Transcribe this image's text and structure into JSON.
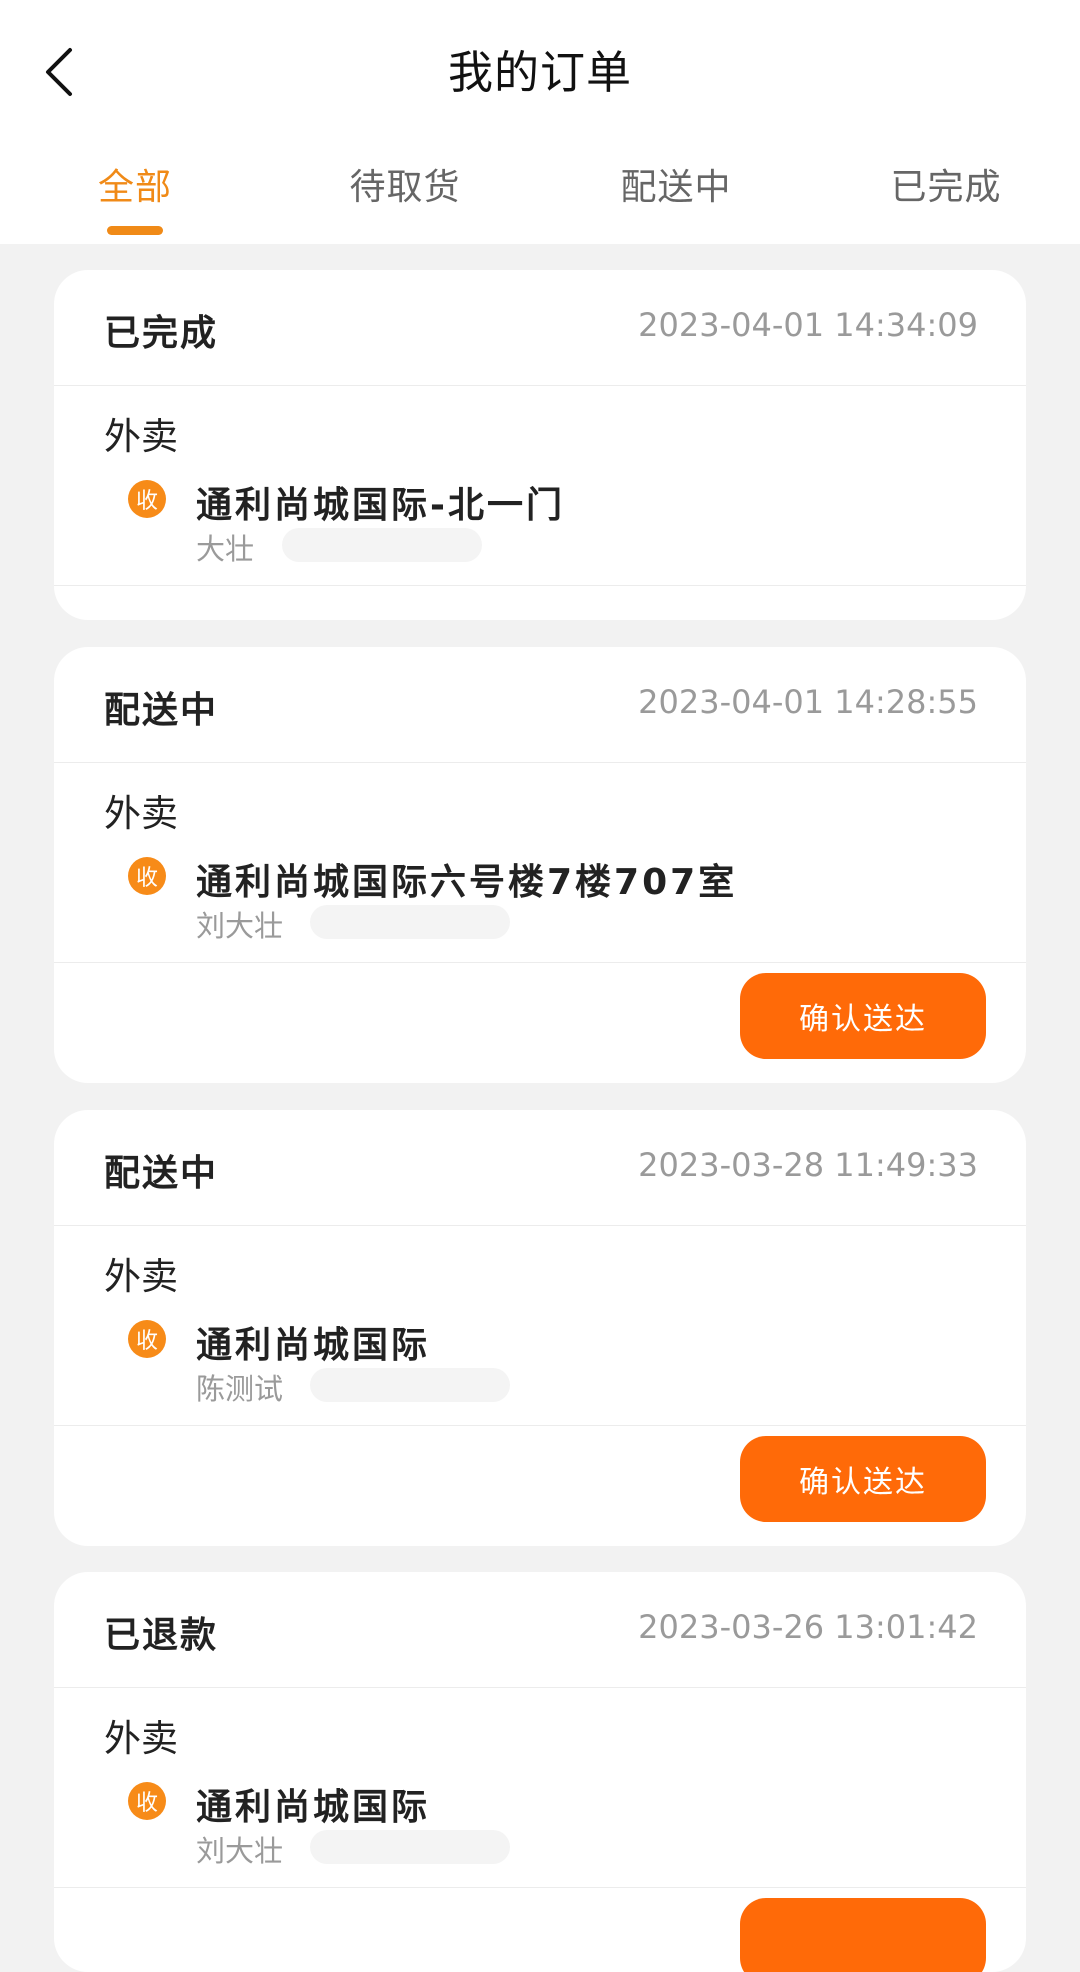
{
  "header": {
    "title": "我的订单",
    "back_icon": "chevron-left-icon"
  },
  "tabs": [
    {
      "label": "全部",
      "active": true
    },
    {
      "label": "待取货",
      "active": false
    },
    {
      "label": "配送中",
      "active": false
    },
    {
      "label": "已完成",
      "active": false
    }
  ],
  "orders": [
    {
      "status": "已完成",
      "time": "2023-04-01 14:34:09",
      "type": "外卖",
      "badge": "收",
      "address": "通利尚城国际-北一门",
      "name": "大壮",
      "action": ""
    },
    {
      "status": "配送中",
      "time": "2023-04-01 14:28:55",
      "type": "外卖",
      "badge": "收",
      "address": "通利尚城国际六号楼7楼707室",
      "name": "刘大壮",
      "action": "确认送达"
    },
    {
      "status": "配送中",
      "time": "2023-03-28 11:49:33",
      "type": "外卖",
      "badge": "收",
      "address": "通利尚城国际",
      "name": "陈测试",
      "action": "确认送达"
    },
    {
      "status": "已退款",
      "time": "2023-03-26 13:01:42",
      "type": "外卖",
      "badge": "收",
      "address": "通利尚城国际",
      "name": "刘大壮",
      "action": ""
    }
  ],
  "colors": {
    "accent": "#f08a17",
    "button": "#ff6a08",
    "background": "#f2f2f2"
  }
}
